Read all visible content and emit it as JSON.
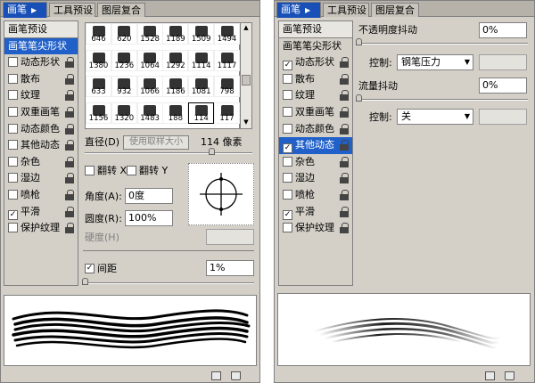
{
  "panelA": {
    "tabs": [
      {
        "label": "画笔"
      },
      {
        "label": "工具预设"
      },
      {
        "label": "图层复合"
      }
    ],
    "list": [
      {
        "label": "画笔预设",
        "type": "head"
      },
      {
        "label": "画笔笔尖形状",
        "type": "selected"
      },
      {
        "label": "动态形状",
        "checked": false
      },
      {
        "label": "散布",
        "checked": false
      },
      {
        "label": "纹理",
        "checked": false
      },
      {
        "label": "双重画笔",
        "checked": false
      },
      {
        "label": "动态颜色",
        "checked": false
      },
      {
        "label": "其他动态",
        "checked": false
      },
      {
        "label": "杂色",
        "checked": false
      },
      {
        "label": "湿边",
        "checked": false
      },
      {
        "label": "喷枪",
        "checked": false
      },
      {
        "label": "平滑",
        "checked": true
      },
      {
        "label": "保护纹理",
        "checked": false
      }
    ],
    "brush_sizes": [
      "646",
      "620",
      "1528",
      "1189",
      "1509",
      "1494",
      "1380",
      "1236",
      "1064",
      "1292",
      "1114",
      "1117",
      "633",
      "932",
      "1066",
      "1186",
      "1081",
      "798",
      "1156",
      "1320",
      "1483",
      "188",
      "114",
      "117"
    ],
    "diameter_label": "直径(D)",
    "use_sample_size": "使用取样大小",
    "diameter_value": "114 像素",
    "flip_x": "翻转 X",
    "flip_y": "翻转 Y",
    "angle_label": "角度(A):",
    "angle_value": "0度",
    "roundness_label": "圆度(R):",
    "roundness_value": "100%",
    "hardness_label": "硬度(H)",
    "spacing_label": "间距",
    "spacing_checked": true,
    "spacing_value": "1%"
  },
  "panelB": {
    "tabs": [
      {
        "label": "画笔"
      },
      {
        "label": "工具预设"
      },
      {
        "label": "图层复合"
      }
    ],
    "list": [
      {
        "label": "画笔预设",
        "type": "head"
      },
      {
        "label": "画笔笔尖形状",
        "type": "plain"
      },
      {
        "label": "动态形状",
        "checked": true
      },
      {
        "label": "散布",
        "checked": false
      },
      {
        "label": "纹理",
        "checked": false
      },
      {
        "label": "双重画笔",
        "checked": false
      },
      {
        "label": "动态颜色",
        "checked": false
      },
      {
        "label": "其他动态",
        "checked": true,
        "type": "selected"
      },
      {
        "label": "杂色",
        "checked": false
      },
      {
        "label": "湿边",
        "checked": false
      },
      {
        "label": "喷枪",
        "checked": false
      },
      {
        "label": "平滑",
        "checked": true
      },
      {
        "label": "保护纹理",
        "checked": false
      }
    ],
    "opacity_jitter_label": "不透明度抖动",
    "opacity_jitter_value": "0%",
    "control_label": "控制:",
    "control1_value": "钢笔压力",
    "flow_jitter_label": "流量抖动",
    "flow_jitter_value": "0%",
    "control2_value": "关"
  },
  "colors": {
    "tab_active": "#1850b8",
    "selected_row": "#2060c8",
    "panel_bg": "#d4d0c8"
  }
}
